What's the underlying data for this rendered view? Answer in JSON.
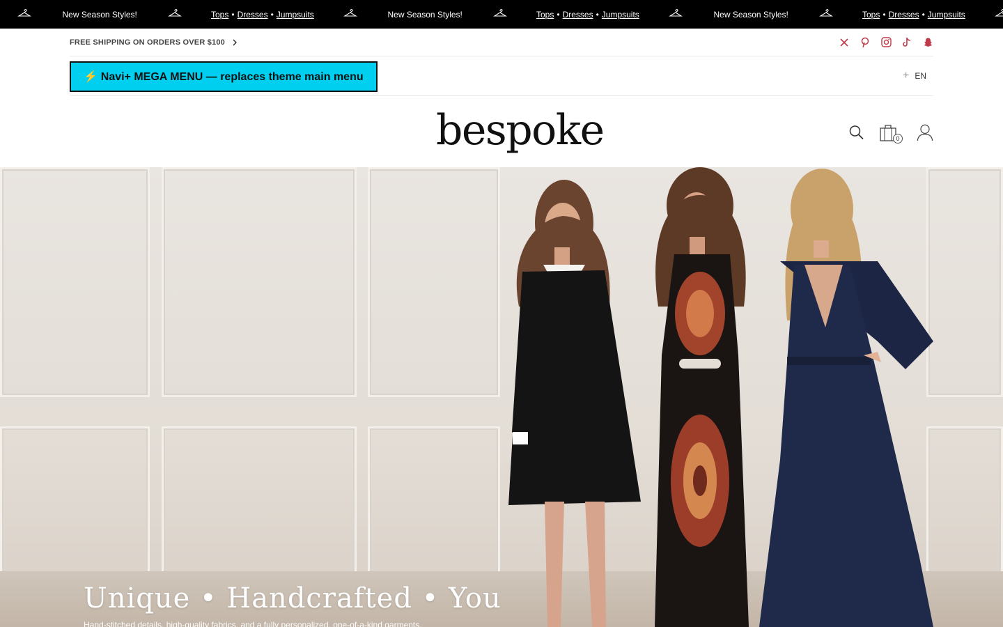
{
  "announcement": {
    "items": [
      {
        "type": "text",
        "text": "New Season Styles!"
      },
      {
        "type": "links",
        "links": [
          "Tops",
          "Dresses",
          "Jumpsuits"
        ],
        "separator": "•"
      },
      {
        "type": "text",
        "text": "New Season Styles!"
      },
      {
        "type": "links",
        "links": [
          "Tops",
          "Dresses",
          "Jumpsuits"
        ],
        "separator": "•"
      },
      {
        "type": "text",
        "text": "New Season Styles!"
      },
      {
        "type": "links",
        "links": [
          "Tops",
          "Dresses",
          "Jumpsuits"
        ],
        "separator": "•"
      }
    ],
    "icon": "hanger-icon"
  },
  "utility": {
    "shipping_text": "FREE SHIPPING ON ORDERS OVER $100",
    "socials": [
      "x-icon",
      "pinterest-icon",
      "instagram-icon",
      "tiktok-icon",
      "snapchat-icon"
    ],
    "social_color": "#c0394b"
  },
  "menu": {
    "mega_label": "⚡ Navi+ MEGA MENU — replaces theme main menu",
    "mega_color": "#00cfef",
    "language": "EN"
  },
  "header": {
    "logo": "bespoke",
    "cart_count": "0",
    "icons": [
      "search-icon",
      "cart-icon",
      "account-icon"
    ]
  },
  "hero": {
    "title": "Unique • Handcrafted • You",
    "subtitle": "Hand-stitched details, high-quality fabrics, and a fully personalized, one-of-a-kind garments."
  }
}
